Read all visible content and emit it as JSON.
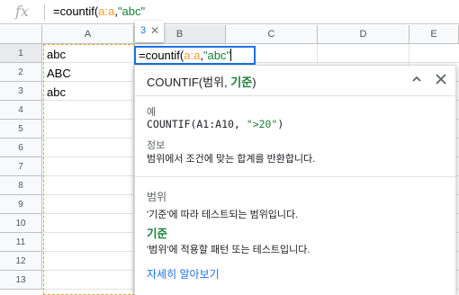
{
  "formula_bar": {
    "fx_label": "fx",
    "prefix": "=countif(",
    "range_ref": "a:a",
    "comma": ",",
    "criterion": "\"abc\""
  },
  "columns": [
    "A",
    "B",
    "C",
    "D",
    "E"
  ],
  "rows": [
    "1",
    "2",
    "3",
    "4",
    "5",
    "6",
    "7",
    "8",
    "9",
    "10",
    "11",
    "12",
    "13"
  ],
  "cells": {
    "A1": "abc",
    "A2": "ABC",
    "A3": "abc"
  },
  "active_cell": {
    "address": "B1",
    "prefix": "=countif(",
    "range_ref": "a:a",
    "comma": ",",
    "criterion": "\"abc\""
  },
  "ref_badge": {
    "count": "3",
    "close_icon": "close-icon"
  },
  "help_popup": {
    "function_name": "COUNTIF(",
    "arg1": "범위",
    "separator": ", ",
    "arg2_current": "기준",
    "close_paren": ")",
    "example_label": "예",
    "example_prefix": "COUNTIF(A1:A10, ",
    "example_string": "\">20\"",
    "example_suffix": ")",
    "info_label": "정보",
    "info_text": "범위에서 조건에 맞는 합계를 반환합니다.",
    "arg1_name": "범위",
    "arg1_desc": "'기준'에 따라 테스트되는 범위입니다.",
    "arg2_name": "기준",
    "arg2_desc": "'범위'에 적용할 패턴 또는 테스트입니다.",
    "learn_more": "자세히 알아보기",
    "collapse_icon": "chevron-up-icon",
    "close_icon": "close-icon"
  },
  "colors": {
    "accent": "#1a73e8",
    "range_highlight": "#e6a23c",
    "string_green": "#188038"
  }
}
